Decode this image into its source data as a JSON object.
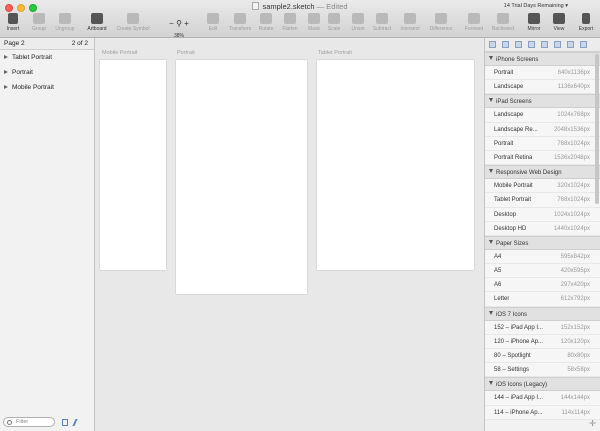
{
  "window": {
    "title": "sample2.sketch",
    "edited": "— Edited",
    "trial": "14 Trial Days Remaining ▾"
  },
  "toolbar": {
    "insert": "Insert",
    "group": "Group",
    "ungroup": "Ungroup",
    "artboard": "Artboard",
    "create_symbol": "Create Symbol",
    "zoom": "38%",
    "edit": "Edit",
    "transform": "Transform",
    "rotate": "Rotate",
    "flatten": "Flatten",
    "mask": "Mask",
    "scale": "Scale",
    "union": "Union",
    "subtract": "Subtract",
    "intersect": "Intersect",
    "difference": "Difference",
    "forward": "Forward",
    "backward": "Backward",
    "mirror": "Mirror",
    "view": "View",
    "export": "Export"
  },
  "left": {
    "page": "Page 2",
    "page_count": "2 of 2",
    "layers": [
      "Tablet Portrait",
      "Portrait",
      "Mobile Portrait"
    ],
    "filter_placeholder": "Filter"
  },
  "canvas": {
    "labels": {
      "mobile": "Mobile Portrait",
      "portrait": "Portrait",
      "tablet": "Tablet Portrait"
    }
  },
  "inspector": {
    "sections": [
      {
        "title": "iPhone Screens",
        "items": [
          {
            "name": "Portrait",
            "size": "640x1136px"
          },
          {
            "name": "Landscape",
            "size": "1136x640px"
          }
        ]
      },
      {
        "title": "iPad Screens",
        "items": [
          {
            "name": "Landscape",
            "size": "1024x768px"
          },
          {
            "name": "Landscape Re...",
            "size": "2048x1536px"
          },
          {
            "name": "Portrait",
            "size": "768x1024px"
          },
          {
            "name": "Portrait Retina",
            "size": "1536x2048px"
          }
        ]
      },
      {
        "title": "Responsive Web Design",
        "items": [
          {
            "name": "Mobile Portrait",
            "size": "320x1024px"
          },
          {
            "name": "Tablet Portrait",
            "size": "768x1024px"
          },
          {
            "name": "Desktop",
            "size": "1024x1024px"
          },
          {
            "name": "Desktop HD",
            "size": "1440x1024px"
          }
        ]
      },
      {
        "title": "Paper Sizes",
        "items": [
          {
            "name": "A4",
            "size": "595x842px"
          },
          {
            "name": "A5",
            "size": "420x595px"
          },
          {
            "name": "A6",
            "size": "297x420px"
          },
          {
            "name": "Letter",
            "size": "612x792px"
          }
        ]
      },
      {
        "title": "iOS 7 Icons",
        "items": [
          {
            "name": "152 – iPad App I...",
            "size": "152x152px"
          },
          {
            "name": "120 – iPhone Ap...",
            "size": "120x120px"
          },
          {
            "name": "80 – Spotlight",
            "size": "80x80px"
          },
          {
            "name": "58 – Settings",
            "size": "58x58px"
          }
        ]
      },
      {
        "title": "iOS Icons (Legacy)",
        "items": [
          {
            "name": "144 – iPad App I...",
            "size": "144x144px"
          },
          {
            "name": "114 – iPhone Ap...",
            "size": "114x114px"
          }
        ]
      }
    ]
  },
  "colors": {
    "close": "#fc5f57",
    "minimize": "#fdbb2e",
    "maximize": "#29c840"
  }
}
